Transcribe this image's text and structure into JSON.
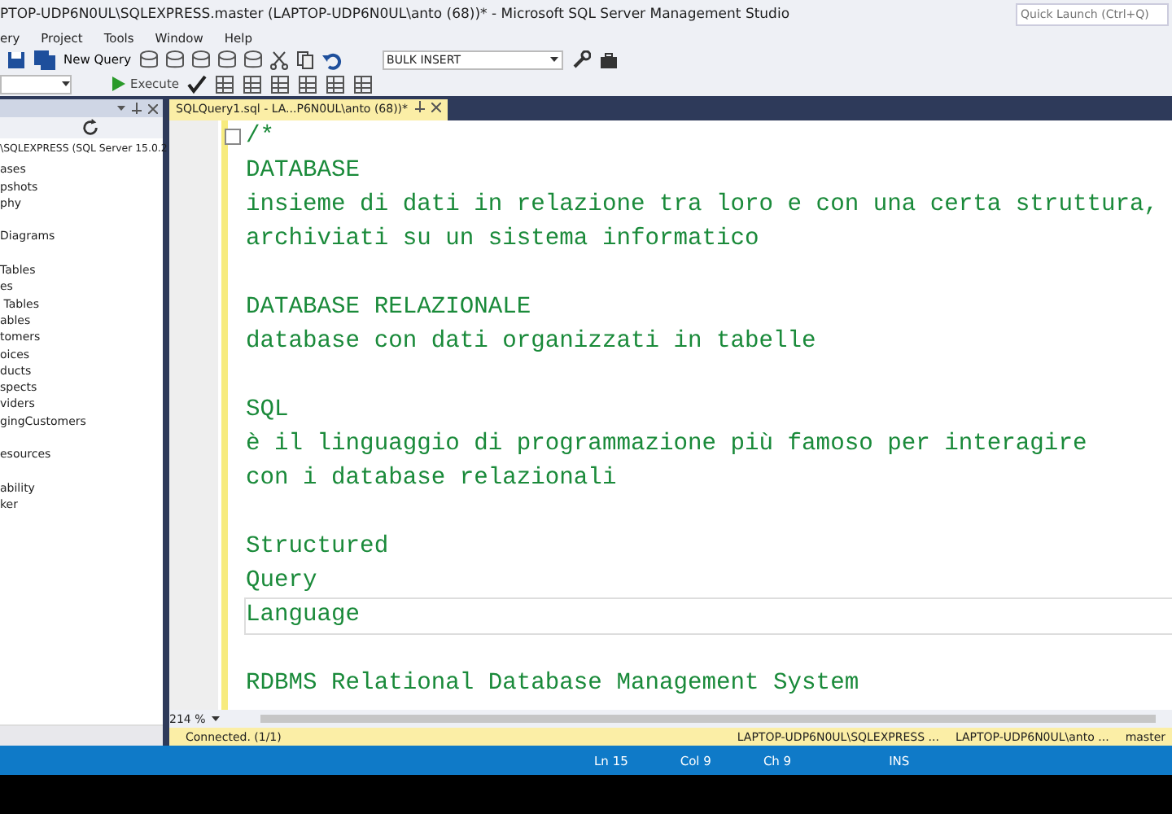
{
  "window": {
    "title": "PTOP-UDP6N0UL\\SQLEXPRESS.master (LAPTOP-UDP6N0UL\\anto (68))* - Microsoft SQL Server Management Studio",
    "quick_launch": {
      "placeholder": "Quick Launch (Ctrl+Q)"
    }
  },
  "menu": [
    "ery",
    "Project",
    "Tools",
    "Window",
    "Help"
  ],
  "toolbar": {
    "new_query": "New Query",
    "execute": "Execute",
    "combo": "BULK INSERT"
  },
  "object_explorer": {
    "server": "\\SQLEXPRESS (SQL Server 15.0.2",
    "groups": [
      {
        "items": [
          "ases",
          "pshots",
          "phy"
        ]
      },
      {
        "items": [
          "Diagrams"
        ]
      },
      {
        "items": [
          "Tables",
          "es",
          " Tables",
          "ables",
          "tomers",
          "oices",
          "ducts",
          "spects",
          "viders",
          "gingCustomers"
        ]
      },
      {
        "items": [
          "esources"
        ]
      },
      {
        "items": [
          "ability",
          "ker"
        ]
      }
    ]
  },
  "tab": {
    "label": "SQLQuery1.sql - LA...P6N0UL\\anto (68))*",
    "selected": true
  },
  "editor": {
    "zoom": "214 %",
    "blocks": [
      {
        "lines": [
          {
            "text": "/*",
            "current": false
          },
          {
            "text": "DATABASE",
            "current": false
          },
          {
            "text": "insieme di dati in relazione tra loro e con una certa struttura,",
            "current": false
          },
          {
            "text": "archiviati su un sistema informatico",
            "current": false
          }
        ]
      },
      {
        "lines": [
          {
            "text": "DATABASE RELAZIONALE",
            "current": false
          },
          {
            "text": "database con dati organizzati in tabelle",
            "current": false
          }
        ]
      },
      {
        "lines": [
          {
            "text": "SQL",
            "current": false
          },
          {
            "text": "è il linguaggio di programmazione più famoso per interagire",
            "current": false
          },
          {
            "text": "con i database relazionali",
            "current": false
          }
        ]
      },
      {
        "lines": [
          {
            "text": "Structured",
            "current": false
          },
          {
            "text": "Query",
            "current": false
          },
          {
            "text": "Language",
            "current": true
          }
        ]
      },
      {
        "lines": [
          {
            "text": "RDBMS Relational Database Management System",
            "current": false
          }
        ]
      }
    ]
  },
  "query_status": {
    "connected": "Connected. (1/1)",
    "server": "LAPTOP-UDP6N0UL\\SQLEXPRESS ...",
    "user": "LAPTOP-UDP6N0UL\\anto ...",
    "database": "master"
  },
  "status_bar": {
    "ln": "Ln 15",
    "col": "Col 9",
    "ch": "Ch 9",
    "mode": "INS"
  }
}
